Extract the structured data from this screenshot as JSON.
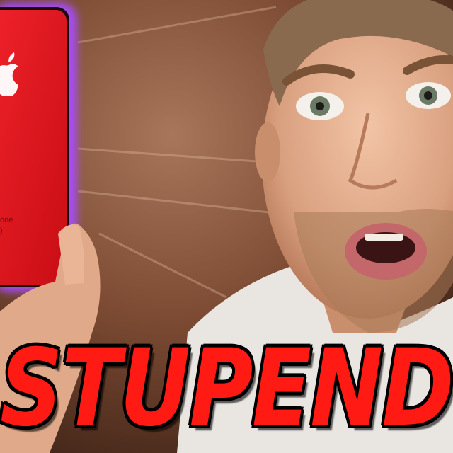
{
  "thumbnail": {
    "headline": "STUPENDO",
    "phone_model_text": "one",
    "phone_sub_text": ")",
    "colors": {
      "phone_red": "#e4141a",
      "glow": "#a84cff",
      "headline_red": "#ff1a14",
      "background": "#6b3e2a"
    }
  }
}
